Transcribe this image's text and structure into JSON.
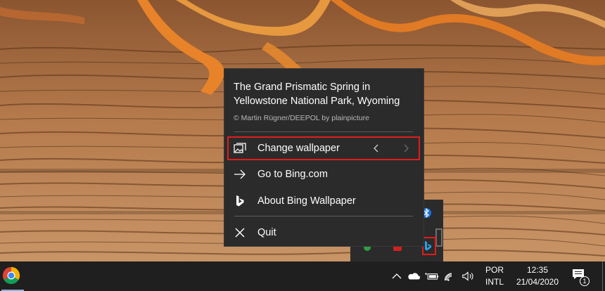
{
  "menu": {
    "title": "The Grand Prismatic Spring in Yellowstone National Park, Wyoming",
    "credit": "© Martin Rügner/DEEPOL by plainpicture",
    "items": [
      {
        "label": "Change wallpaper",
        "icon": "wallpaper-icon"
      },
      {
        "label": "Go to Bing.com",
        "icon": "arrow-right-icon"
      },
      {
        "label": "About Bing Wallpaper",
        "icon": "bing-logo-icon"
      },
      {
        "label": "Quit",
        "icon": "close-icon"
      }
    ]
  },
  "taskbar": {
    "language_top": "POR",
    "language_bottom": "INTL",
    "time": "12:35",
    "date": "21/04/2020",
    "notification_count": "1"
  },
  "colors": {
    "highlight": "#e01d1d",
    "menu_bg": "#2b2b2b",
    "taskbar_bg": "#1f1f1f",
    "bing_blue": "#2aa1e8"
  }
}
